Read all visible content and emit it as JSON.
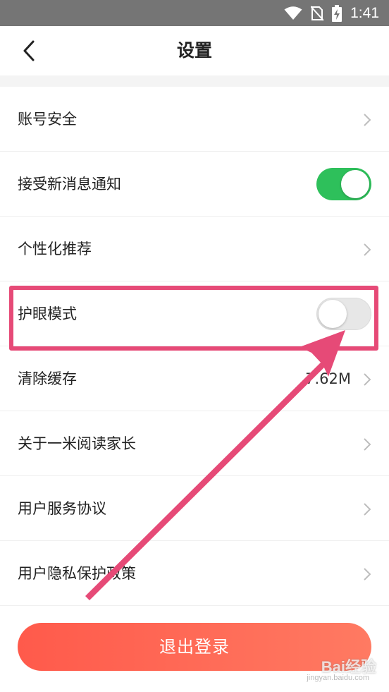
{
  "status_bar": {
    "time": "1:41",
    "icons": [
      "wifi-icon",
      "no-sim-icon",
      "battery-charging-icon"
    ]
  },
  "header": {
    "back_icon": "chevron-left-icon",
    "title": "设置"
  },
  "settings": {
    "account_security": "账号安全",
    "new_message_notify": "接受新消息通知",
    "new_message_notify_on": true,
    "personalized": "个性化推荐",
    "eye_care": "护眼模式",
    "eye_care_on": false,
    "clear_cache": "清除缓存",
    "cache_size": "7.62M",
    "about": "关于一米阅读家长",
    "user_agreement": "用户服务协议",
    "privacy_policy": "用户隐私保护政策"
  },
  "logout_label": "退出登录",
  "colors": {
    "toggle_on": "#2ec05b",
    "annotation": "#e64a77",
    "logout_start": "#ff5a4b",
    "logout_end": "#ff7a62"
  },
  "watermark": {
    "brand": "Bai经验",
    "url": "jingyan.baidu.com"
  }
}
